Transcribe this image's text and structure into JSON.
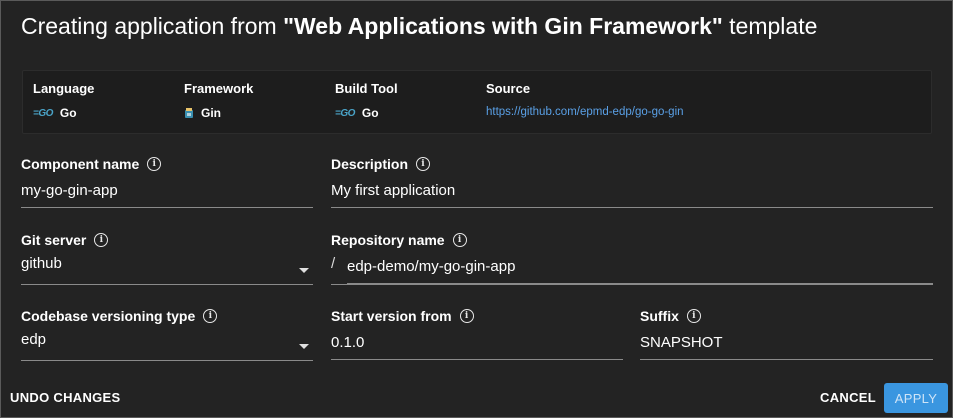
{
  "dialog": {
    "title_prefix": "Creating application from ",
    "title_template": "\"Web Applications with Gin Framework\"",
    "title_suffix": " template"
  },
  "info": {
    "language": {
      "label": "Language",
      "value": "Go",
      "icon": "go-icon"
    },
    "framework": {
      "label": "Framework",
      "value": "Gin",
      "icon": "gin-icon"
    },
    "build_tool": {
      "label": "Build Tool",
      "value": "Go",
      "icon": "go-icon"
    },
    "source": {
      "label": "Source",
      "value": "https://github.com/epmd-edp/go-go-gin"
    }
  },
  "icons": {
    "go_glyph": "=GO",
    "info_glyph": "i"
  },
  "form": {
    "component_name": {
      "label": "Component name",
      "value": "my-go-gin-app"
    },
    "description": {
      "label": "Description",
      "value": "My first application"
    },
    "git_server": {
      "label": "Git server",
      "value": "github"
    },
    "repository_name": {
      "label": "Repository name",
      "prefix": "/",
      "value": "edp-demo/my-go-gin-app"
    },
    "versioning_type": {
      "label": "Codebase versioning type",
      "value": "edp"
    },
    "start_version": {
      "label": "Start version from",
      "value": "0.1.0"
    },
    "suffix": {
      "label": "Suffix",
      "value": "SNAPSHOT"
    }
  },
  "actions": {
    "undo": "UNDO CHANGES",
    "cancel": "CANCEL",
    "apply": "APPLY"
  },
  "colors": {
    "background": "#232323",
    "link": "#5aa0e6",
    "apply": "#3a96e0"
  }
}
